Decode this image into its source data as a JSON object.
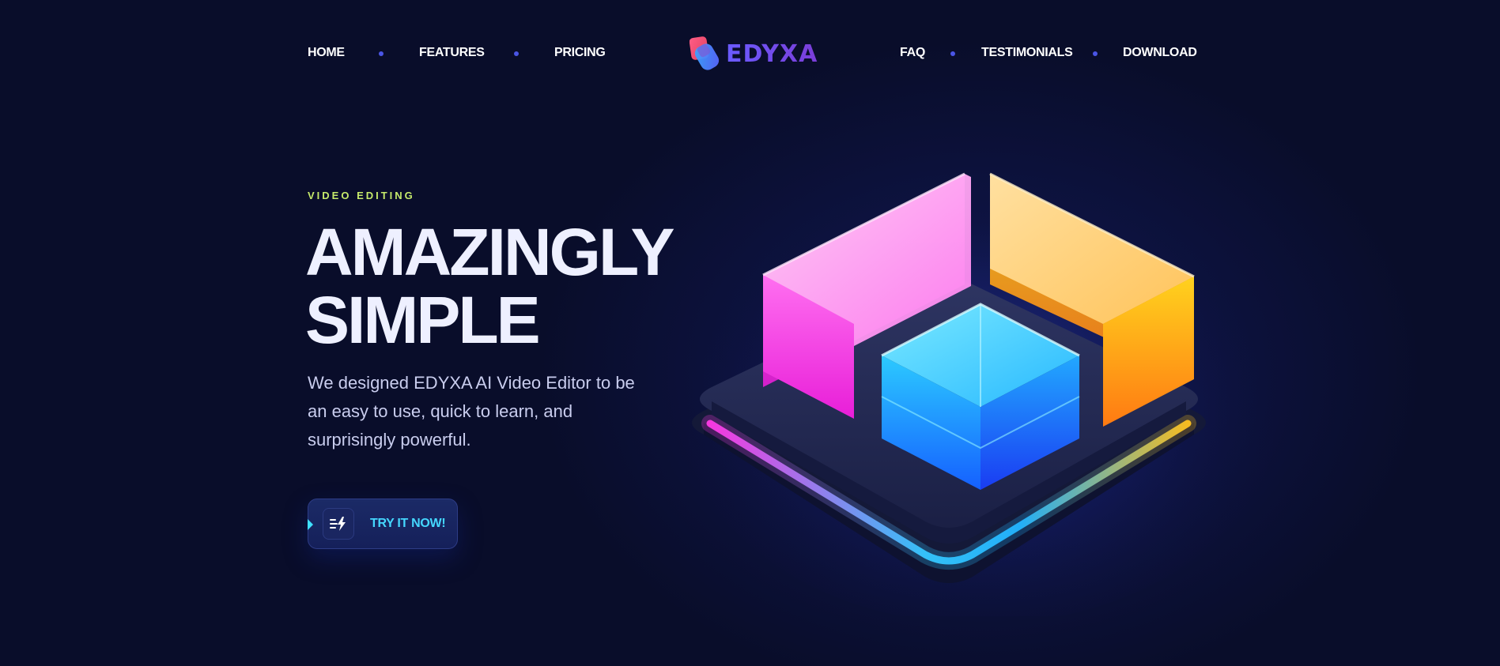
{
  "nav": {
    "home": "HOME",
    "features": "FEATURES",
    "pricing": "PRICING",
    "faq": "FAQ",
    "testimonials": "TESTIMONIALS",
    "download": "DOWNLOAD"
  },
  "logo": {
    "text": "EDYXA"
  },
  "hero": {
    "eyebrow": "VIDEO EDITING",
    "headline_line1": "AMAZINGLY",
    "headline_line2": "SIMPLE",
    "description": "We designed EDYXA AI Video Editor to be an easy to use, quick to learn, and surprisingly powerful.",
    "cta_label": "TRY IT NOW!"
  },
  "icons": {
    "cta_icon": "lightning-list-icon",
    "illustration": "3d-blocks-illustration"
  },
  "colors": {
    "background": "#090d2a",
    "accent": "#45d7ff",
    "eyebrow": "#c6ea6b",
    "nav_dot": "#4a55e6"
  }
}
